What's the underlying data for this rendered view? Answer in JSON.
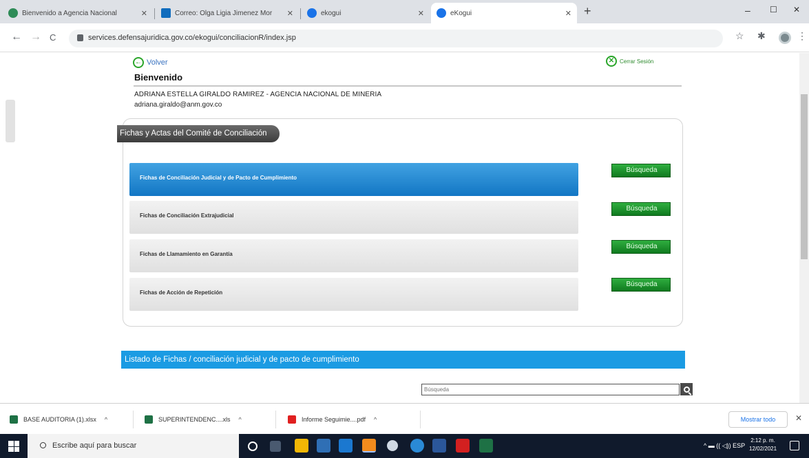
{
  "browser": {
    "tabs": [
      {
        "title": "Bienvenido a Agencia Nacional",
        "favicon_color": "#2e8b57",
        "active": false
      },
      {
        "title": "Correo: Olga Ligia Jimenez Mor",
        "favicon_color": "#0f6cbd",
        "active": false
      },
      {
        "title": "ekogui",
        "favicon_color": "#1a73e8",
        "active": false
      },
      {
        "title": "eKogui",
        "favicon_color": "#1a73e8",
        "active": true
      }
    ],
    "new_tab": "+",
    "window_controls": {
      "minimize": "–",
      "maximize": "☐",
      "close": "✕"
    },
    "nav": {
      "back": "←",
      "forward": "→",
      "reload": "C"
    },
    "url": "services.defensajuridica.gov.co/ekogui/conciliacionR/index.jsp",
    "toolbar_icons": {
      "star": "☆",
      "extensions": "✱",
      "menu": "⋮"
    }
  },
  "page": {
    "back_label": "Volver",
    "logout_label": "Cerrar Sesión",
    "welcome": "Bienvenido",
    "user_name": "ADRIANA ESTELLA GIRALDO RAMIREZ - AGENCIA NACIONAL DE MINERIA",
    "user_email": "adriana.giraldo@anm.gov.co",
    "panel_title": "Fichas y Actas del Comité de Conciliación",
    "rows": [
      {
        "label": "Fichas de Conciliación Judicial y de Pacto de Cumplimiento",
        "active": true,
        "button": "Búsqueda"
      },
      {
        "label": "Fichas de Conciliación Extrajudicial",
        "active": false,
        "button": "Búsqueda"
      },
      {
        "label": "Fichas de Llamamiento en Garantía",
        "active": false,
        "button": "Búsqueda"
      },
      {
        "label": "Fichas de Acción de Repetición",
        "active": false,
        "button": "Búsqueda"
      }
    ],
    "listing_title": "Listado de Fichas / conciliación judicial y de pacto de cumplimiento",
    "search_placeholder": "Búsqueda"
  },
  "downloads": {
    "items": [
      {
        "name": "BASE AUDITORIA (1).xlsx",
        "icon_color": "#1e7145"
      },
      {
        "name": "SUPERINTENDENC....xls",
        "icon_color": "#1e7145"
      },
      {
        "name": "Informe Seguimie....pdf",
        "icon_color": "#e02020"
      }
    ],
    "chevron": "^",
    "show_all": "Mostrar todo",
    "close": "✕"
  },
  "taskbar": {
    "search_placeholder": "Escribe aquí para buscar",
    "tray": "^ ▬ ((  ◁)) ESP",
    "time": "2:12 p. m.",
    "date": "12/02/2021"
  },
  "colors": {
    "accent_blue": "#1b9be3",
    "search_button_green": "#1f9a31",
    "panel_tab_gray": "#4c4c4c"
  }
}
